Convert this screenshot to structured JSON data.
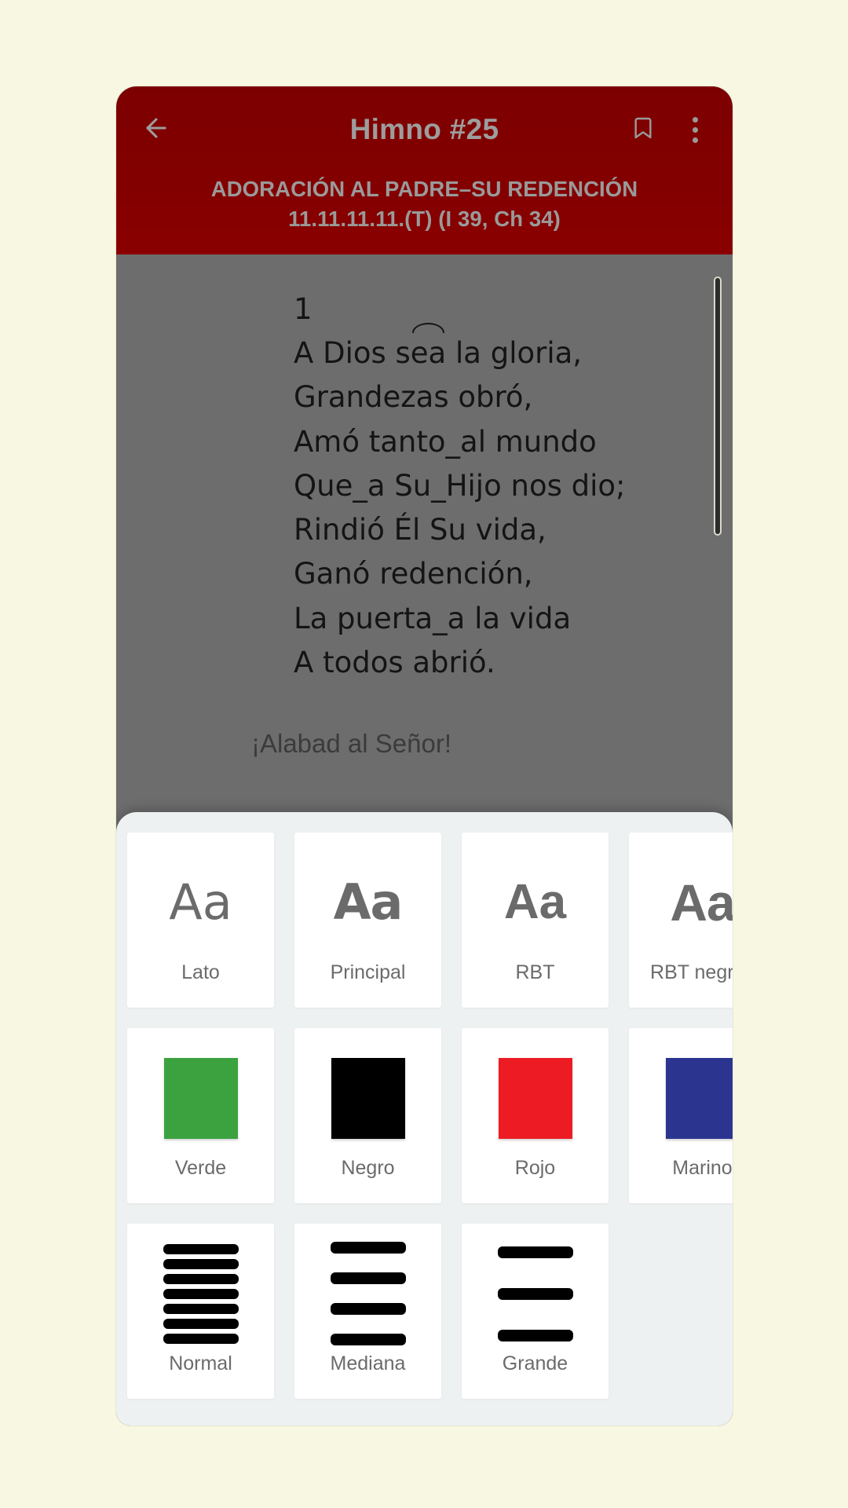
{
  "appbar": {
    "back_icon": "arrow-left-icon",
    "title": "Himno #25",
    "bookmark_icon": "bookmark-icon",
    "overflow_icon": "more-vertical-icon",
    "subtitle_line1": "ADORACIÓN AL PADRE–SU REDENCIÓN",
    "subtitle_line2": "11.11.11.11.(T) (I 39, Ch 34)"
  },
  "lyrics": {
    "stanza_number": "1",
    "lines": [
      "A Dios s",
      "ea",
      " la gloria,"
    ],
    "line1_pre": "A Dios s",
    "line1_tie": "ea",
    "line1_post": " la gloria,",
    "line2": "Grandezas obró,",
    "line3": "Amó tanto_al mundo",
    "line4": "Que_a Su_Hijo nos dio;",
    "line5": "Rindió Él Su vida,",
    "line6": "Ganó redención,",
    "line7": "La puerta_a la vida",
    "line8": "A todos abrió.",
    "refrain": "¡Alabad al Señor!"
  },
  "sheet": {
    "fonts": [
      {
        "sample": "Aa",
        "label": "Lato"
      },
      {
        "sample": "Aa",
        "label": "Principal"
      },
      {
        "sample": "Aa",
        "label": "RBT"
      },
      {
        "sample": "Aa",
        "label": "RBT negrita"
      }
    ],
    "colors": [
      {
        "label": "Verde",
        "hex": "#3ba23f"
      },
      {
        "label": "Negro",
        "hex": "#000000"
      },
      {
        "label": "Rojo",
        "hex": "#ed1c24"
      },
      {
        "label": "Marino",
        "hex": "#2b3590"
      }
    ],
    "sizes": [
      {
        "label": "Normal",
        "bars": 7
      },
      {
        "label": "Mediana",
        "bars": 4
      },
      {
        "label": "Grande",
        "bars": 3
      }
    ]
  },
  "theme": {
    "appbar_bg": "#7d0000",
    "body_bg": "#6d6d6d",
    "sheet_bg": "#eef1f1",
    "page_bg": "#f7f7e2"
  }
}
